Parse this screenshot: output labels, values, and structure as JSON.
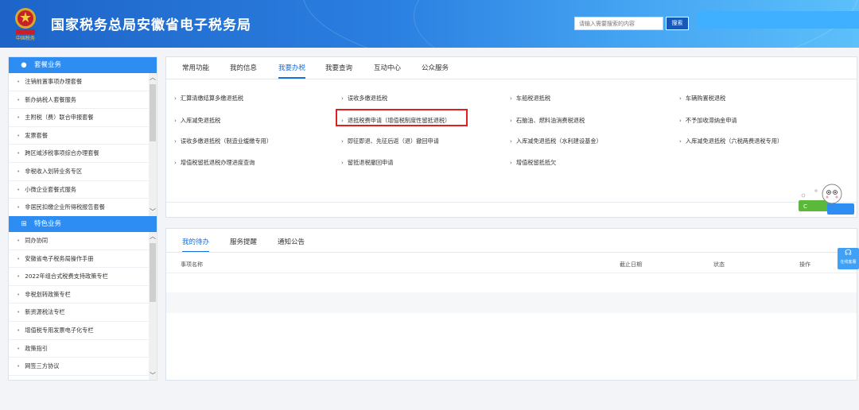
{
  "header": {
    "emblem_text": "中国税务",
    "title": "国家税务总局安徽省电子税务局",
    "search_placeholder": "请输入需要搜索的内容",
    "search_button": "搜索"
  },
  "sidebar": {
    "section1": {
      "title": "套餐业务",
      "items": [
        "注销前置事项办理套餐",
        "新办纳税人套餐服务",
        "主附税（费）联合申报套餐",
        "发票套餐",
        "跨区域涉税事项综合办理套餐",
        "非税收入划转业务专区",
        "小微企业套餐式服务",
        "非居民扣缴企业所得税报告套餐"
      ]
    },
    "section2": {
      "title": "特色业务",
      "items": [
        "同办协同",
        "安徽省电子税务局操作手册",
        "2022年组合式税费支持政策专栏",
        "非税划转政策专栏",
        "新资源税法专栏",
        "增值税专用发票电子化专栏",
        "政策指引",
        "网签三方协议"
      ]
    }
  },
  "top_panel": {
    "tabs": [
      "常用功能",
      "我的信息",
      "我要办税",
      "我要查询",
      "互动中心",
      "公众服务"
    ],
    "active_tab": "我要办税",
    "links": [
      "汇算清缴结算多缴退抵税",
      "误收多缴退抵税",
      "车船税退抵税",
      "车辆购置税退税",
      "入库减免退抵税",
      "退抵税费申请（增值税制度性留抵退税）",
      "石脑油、燃料油消费税退税",
      "不予加收滞纳金申请",
      "误收多缴退抵税（制造业缓缴专用）",
      "即征即退、先征后返（退）撤回申请",
      "入库减免退抵税（水利建设基金）",
      "入库减免退抵税（六税两费退税专用）",
      "增值税留抵退税办理进度查询",
      "留抵退税撤回申请",
      "增值税留抵抵欠"
    ]
  },
  "bottom_panel": {
    "tabs": [
      "我的待办",
      "服务提醒",
      "通知公告"
    ],
    "active_tab": "我的待办",
    "columns": [
      "事项名称",
      "截止日期",
      "状态",
      "操作"
    ]
  },
  "float_button": {
    "label": "在线客服"
  },
  "colors": {
    "header_blue": "#1e64c8",
    "accent": "#1a6ede",
    "sidebar_head": "#2e8df2",
    "highlight_red": "#e02020"
  }
}
